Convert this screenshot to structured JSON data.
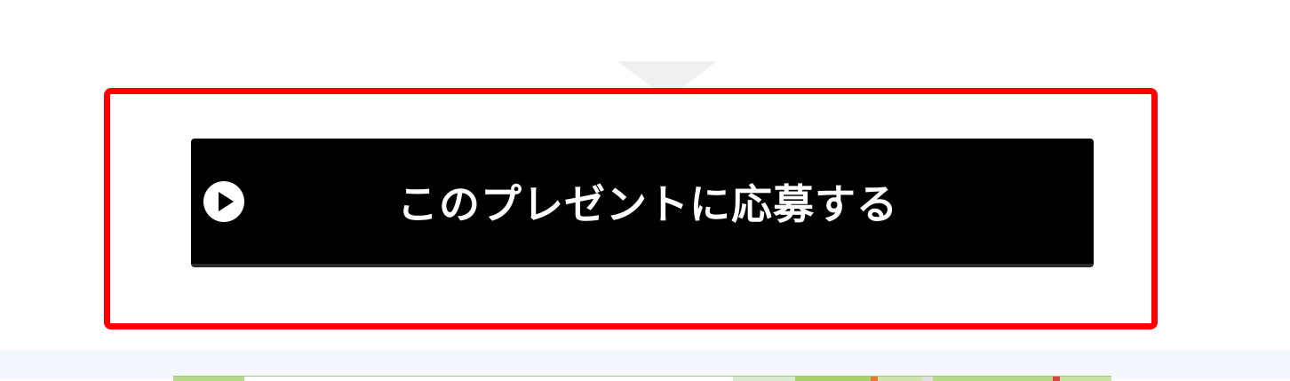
{
  "cta": {
    "label": "このプレゼントに応募する",
    "icon": "play-circle-icon"
  },
  "colors": {
    "highlight_border": "#ff0000",
    "button_bg": "#000000",
    "button_text": "#ffffff",
    "pointer": "#f0f0f0",
    "bottom_band": "#f4f7fc"
  }
}
